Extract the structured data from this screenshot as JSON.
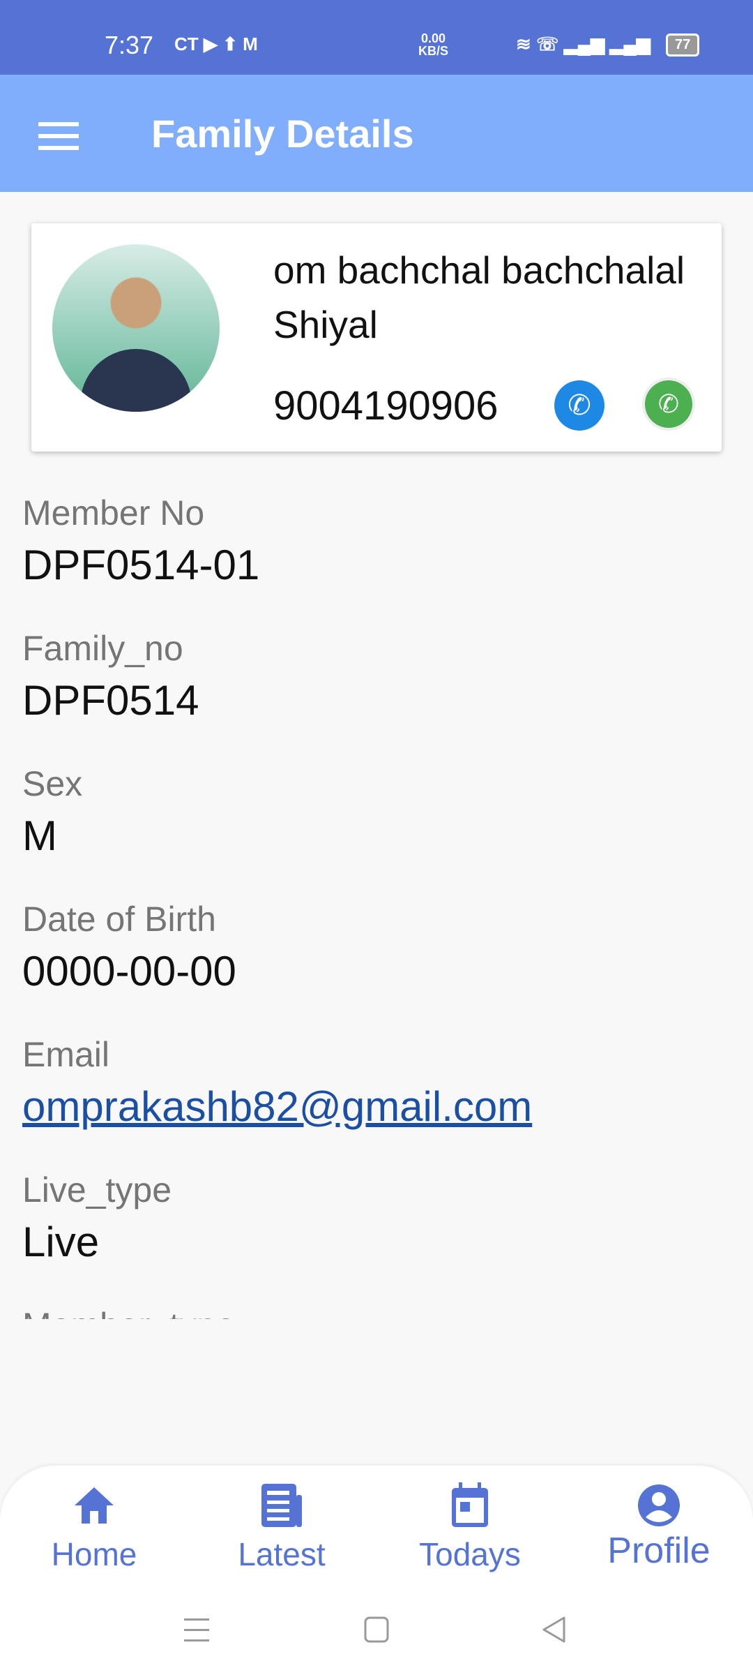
{
  "status_bar": {
    "time": "7:37",
    "net_speed": "0.00",
    "net_unit": "KB/S",
    "battery": "77"
  },
  "app_bar": {
    "title": "Family Details"
  },
  "profile": {
    "name": "om bachchal bachchalal Shiyal",
    "phone": "9004190906"
  },
  "fields": [
    {
      "label": "Member No",
      "value": "DPF0514-01"
    },
    {
      "label": "Family_no",
      "value": "DPF0514"
    },
    {
      "label": "Sex",
      "value": "M"
    },
    {
      "label": "Date of Birth",
      "value": "0000-00-00"
    },
    {
      "label": "Email",
      "value": "omprakashb82@gmail.com"
    },
    {
      "label": "Live_type",
      "value": "Live"
    },
    {
      "label": "Member_type",
      "value": ""
    }
  ],
  "bottom_nav": [
    {
      "label": "Home",
      "icon": "home-icon"
    },
    {
      "label": "Latest",
      "icon": "newspaper-icon"
    },
    {
      "label": "Todays",
      "icon": "calendar-icon"
    },
    {
      "label": "Profile",
      "icon": "account-circle-icon"
    }
  ],
  "colors": {
    "status_bar": "#5573d4",
    "app_bar": "#80aefc",
    "accent": "#5573d4",
    "link": "#1a4fa3"
  }
}
